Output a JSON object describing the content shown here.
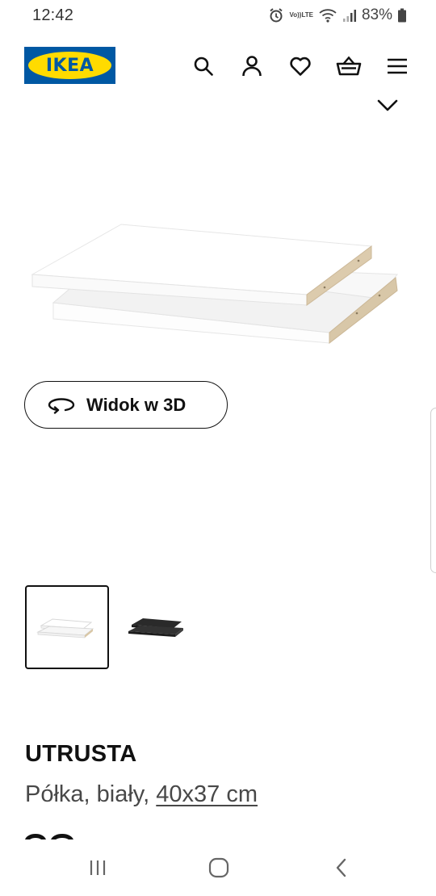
{
  "status_bar": {
    "time": "12:42",
    "battery": "83%",
    "icons": [
      "alarm-icon",
      "volte-lte-icon",
      "wifi-icon",
      "signal-icon",
      "battery-icon"
    ],
    "volte_top": "Vo))",
    "volte_bottom": "LTE"
  },
  "header": {
    "logo_text": "IKEA",
    "icons": [
      "search-icon",
      "account-icon",
      "wishlist-heart-icon",
      "cart-basket-icon",
      "menu-icon"
    ]
  },
  "gallery": {
    "view3d_label": "Widok w 3D",
    "thumbnails": [
      {
        "variant": "white",
        "selected": true
      },
      {
        "variant": "black",
        "selected": false
      }
    ]
  },
  "product": {
    "name": "UTRUSTA",
    "description": "Półka, biały,",
    "size": "40x37 cm"
  },
  "navbar": {
    "icons": [
      "recent-apps-icon",
      "home-icon",
      "back-icon"
    ]
  },
  "colors": {
    "ikea_blue": "#0058a3",
    "ikea_yellow": "#ffdb00",
    "text": "#111111",
    "secondary_text": "#484848"
  }
}
